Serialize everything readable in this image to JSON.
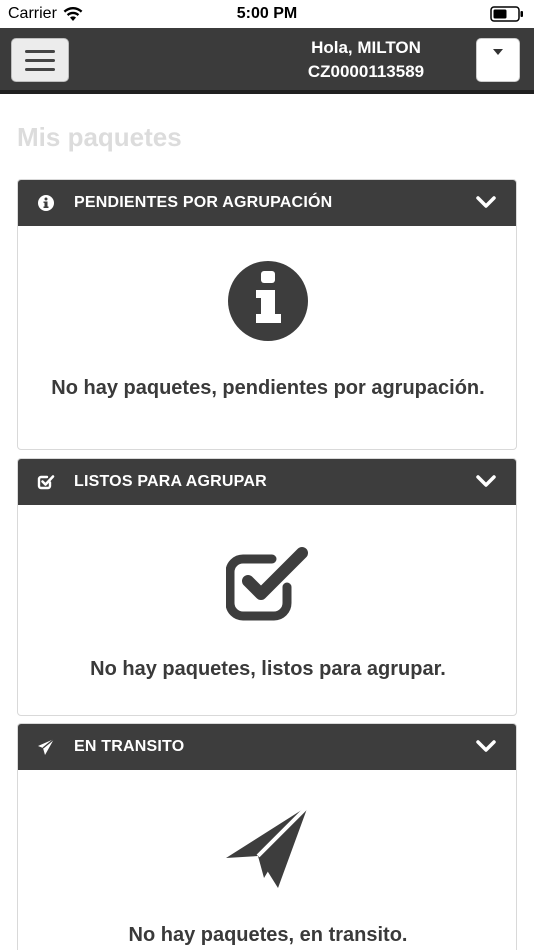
{
  "status_bar": {
    "carrier": "Carrier",
    "time": "5:00 PM"
  },
  "header": {
    "greeting": "Hola, MILTON",
    "account_code": "CZ0000113589",
    "background_color": "#3b3b3b"
  },
  "page": {
    "title": "Mis paquetes"
  },
  "panels": [
    {
      "title": "PENDIENTES POR AGRUPACIÓN",
      "icon": "info-circle-icon",
      "message": "No hay paquetes, pendientes por agrupación."
    },
    {
      "title": "LISTOS PARA AGRUPAR",
      "icon": "checkbox-checked-icon",
      "message": "No hay paquetes, listos para agrupar."
    },
    {
      "title": "EN TRANSITO",
      "icon": "paper-plane-icon",
      "message": "No hay paquetes, en transito."
    }
  ]
}
